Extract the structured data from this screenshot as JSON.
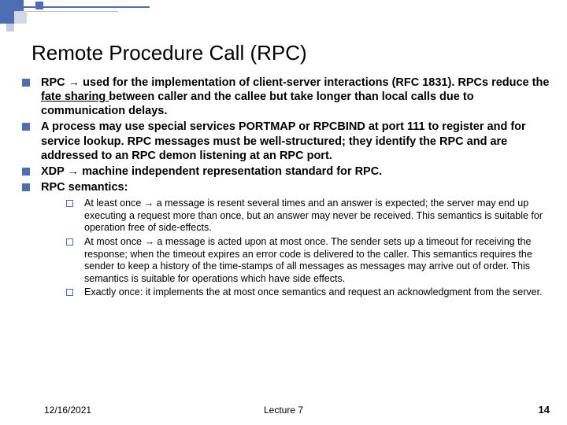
{
  "title": "Remote Procedure Call (RPC)",
  "bullets": [
    {
      "pre": "RPC ",
      "arrow": "→",
      "post": " used for the implementation of client-server interactions (RFC 1831). RPCs reduce the ",
      "underline": "fate sharing ",
      "tail": "between caller and the callee but take longer than local calls due to communication delays."
    },
    {
      "text": "A process may use  special services PORTMAP or RPCBIND at port 111 to register and for service lookup. RPC messages must be well-structured; they identify the  RPC and are addressed to an RPC demon listening at an RPC port."
    },
    {
      "pre": "XDP ",
      "arrow": "→",
      "post": " machine independent representation standard for RPC."
    },
    {
      "text": "RPC semantics:"
    }
  ],
  "subbullets": [
    {
      "pre": "At least once ",
      "arrow": "→",
      "post": " a message is resent several times and an answer is expected; the server may end up executing a request more than once, but an answer may never be received. This semantics is suitable for operation free of side-effects."
    },
    {
      "pre": "At most once ",
      "arrow": "→",
      "post": " a message is acted upon at most once. The sender sets up a timeout for receiving the response; when the timeout expires an error code is delivered to the caller. This semantics requires the sender to keep a history of the time-stamps of all messages as  messages may arrive out of order. This semantics is suitable for operations which have side effects."
    },
    {
      "text": "Exactly once: it implements the  at most once semantics and request an acknowledgment from the server."
    }
  ],
  "footer": {
    "date": "12/16/2021",
    "lecture": "Lecture 7",
    "page": "14"
  }
}
